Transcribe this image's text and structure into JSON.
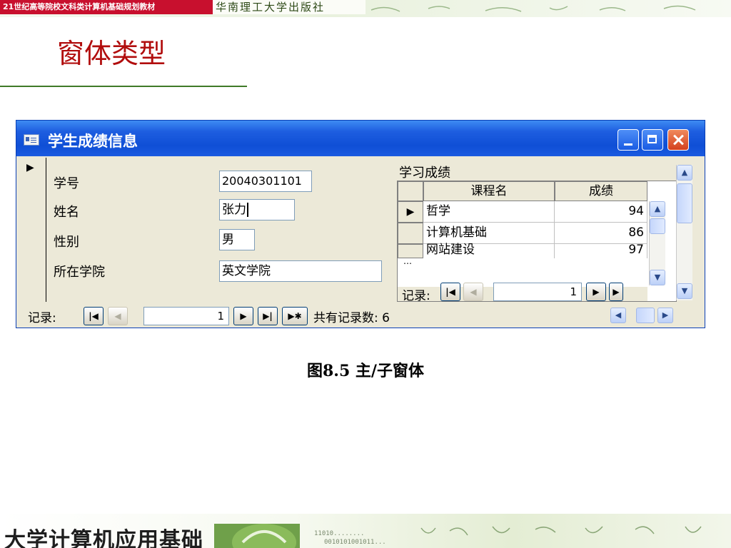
{
  "slide": {
    "banner_left": "21世纪高等院校文科类计算机基础规划教材",
    "banner_publisher": "华南理工大学出版社",
    "title": "窗体类型",
    "caption": "图8.5 主/子窗体",
    "footer_title": "大学计算机应用基础",
    "footer_binary_1": "11010........",
    "footer_binary_2": "0010101001011..."
  },
  "window": {
    "title": "学生成绩信息",
    "icon": "form-icon",
    "controls": [
      "minimize-icon",
      "maximize-icon",
      "close-icon"
    ]
  },
  "main_form": {
    "record_selector": "▶",
    "fields": [
      {
        "label": "学号",
        "value": "20040301101"
      },
      {
        "label": "姓名",
        "value": "张力"
      },
      {
        "label": "性别",
        "value": "男"
      },
      {
        "label": "所在学院",
        "value": "英文学院"
      }
    ],
    "nav": {
      "label": "记录:",
      "current": "1",
      "total_label": "共有记录数: 6",
      "buttons": [
        "first-record-icon",
        "prev-record-icon",
        "next-record-icon",
        "last-record-icon",
        "new-record-icon"
      ]
    }
  },
  "subform": {
    "caption": "学习成绩",
    "columns": [
      "课程名",
      "成绩"
    ],
    "rows": [
      {
        "selector": "▶",
        "course": "哲学",
        "score": "94"
      },
      {
        "selector": "",
        "course": "计算机基础",
        "score": "86"
      },
      {
        "selector": "",
        "course": "网站建设",
        "score": "97"
      }
    ],
    "partial_row_marker": "…",
    "nav": {
      "label": "记录:",
      "current": "1"
    }
  }
}
